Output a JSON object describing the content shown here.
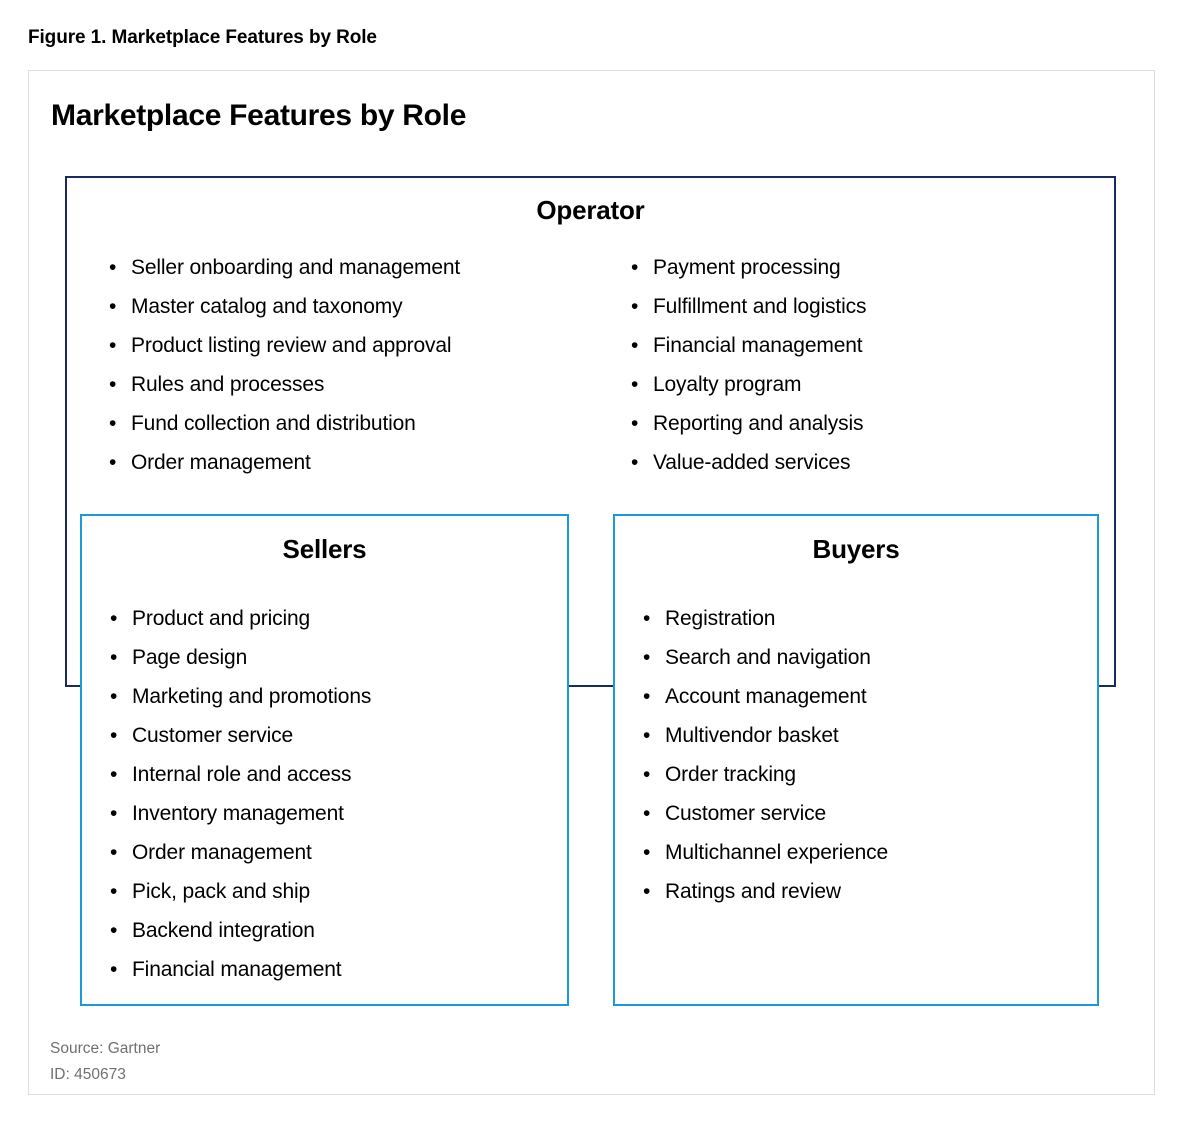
{
  "figure": {
    "caption": "Figure 1. Marketplace Features by Role"
  },
  "card": {
    "title": "Marketplace Features by Role",
    "source": "Source: Gartner",
    "id": "ID: 450673",
    "colors": {
      "operator_border": "#1b2a5e",
      "role_border": "#1a9ad6",
      "card_border": "#dcdcdc",
      "footer_text": "#6e7073",
      "text": "#000000"
    }
  },
  "operator": {
    "title": "Operator",
    "left_items": [
      "Seller onboarding and management",
      "Master catalog and taxonomy",
      "Product listing review and approval",
      "Rules and processes",
      "Fund collection and distribution",
      "Order management"
    ],
    "right_items": [
      "Payment processing",
      "Fulfillment and logistics",
      "Financial management",
      "Loyalty program",
      "Reporting and analysis",
      "Value-added services"
    ]
  },
  "sellers": {
    "title": "Sellers",
    "items": [
      "Product and pricing",
      "Page design",
      "Marketing and promotions",
      "Customer service",
      "Internal role and access",
      "Inventory management",
      "Order management",
      "Pick, pack and ship",
      "Backend integration",
      "Financial management"
    ]
  },
  "buyers": {
    "title": "Buyers",
    "items": [
      "Registration",
      "Search and navigation",
      "Account management",
      "Multivendor basket",
      "Order tracking",
      "Customer service",
      "Multichannel experience",
      "Ratings and review"
    ]
  },
  "bullet_glyph": "•"
}
